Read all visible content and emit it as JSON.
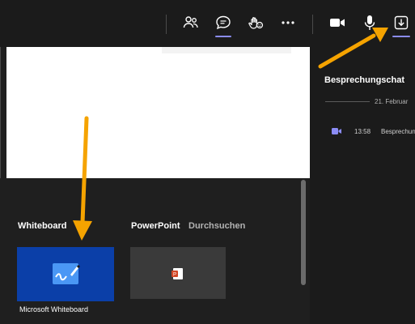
{
  "share_tray": {
    "whiteboard_title": "Whiteboard",
    "whiteboard_tile_caption": "Microsoft Whiteboard",
    "powerpoint_title": "PowerPoint",
    "browse_label": "Durchsuchen"
  },
  "chat": {
    "title": "Besprechungschat",
    "date": "21. Februar",
    "message_time": "13:58",
    "message_text": "Besprechung"
  },
  "toolbar": {
    "icons": [
      "people-icon",
      "chat-icon",
      "reactions-icon",
      "more-icon",
      "camera-icon",
      "mic-icon",
      "share-icon"
    ],
    "active_underline_color": "#8b8cf5"
  },
  "annotation": {
    "arrow_color": "#f5a300"
  }
}
